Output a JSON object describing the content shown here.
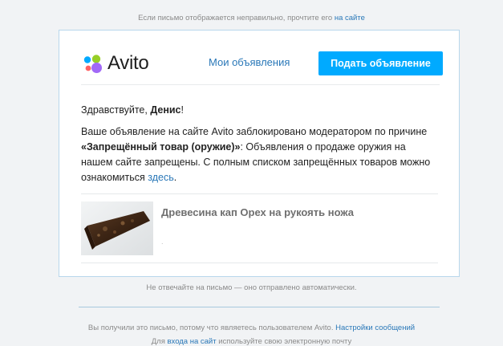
{
  "top_note": {
    "text": "Если письмо отображается неправильно, прочтите его ",
    "link": "на сайте"
  },
  "header": {
    "logo_text": "Avito",
    "my_ads": "Мои объявления",
    "post_ad": "Подать объявление"
  },
  "greeting": {
    "prefix": "Здравствуйте, ",
    "name": "Денис",
    "suffix": "!"
  },
  "message": {
    "part1": "Ваше объявление на сайте Avito заблокировано модератором по причине ",
    "reason": "«Запрещённый товар (оружие)»",
    "part2": ": Объявления о продаже оружия на нашем сайте запрещены. С полным списком запрещённых товаров можно ознакомиться ",
    "link": "здесь",
    "end": "."
  },
  "item": {
    "title": "Древесина кап Орех на рукоять ножа",
    "subtitle": "."
  },
  "no_reply": "Не отвечайте на письмо — оно отправлено автоматически.",
  "footer": {
    "line1_text": "Вы получили это письмо, потому что являетесь пользователем Avito. ",
    "line1_link": "Настройки сообщений",
    "line2_prefix": "Для ",
    "line2_link": "входа на сайт",
    "line2_suffix": " используйте свою электронную почту"
  },
  "colors": {
    "brand_blue": "#00aaff",
    "link_blue": "#2a78b8",
    "card_border": "#b8d7ec"
  }
}
